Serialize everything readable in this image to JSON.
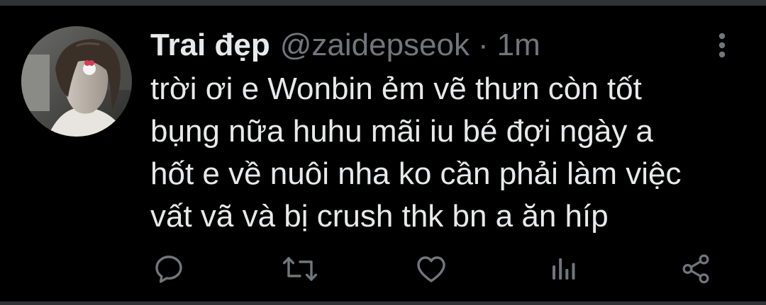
{
  "tweet": {
    "display_name": "Trai đẹp",
    "handle": "@zaidepseok",
    "separator": "·",
    "time": "1m",
    "text_lines": [
      "trời ơi e Wonbin ẻm vẽ thưn còn tốt",
      "bụng nữa huhu mãi iu bé đợi ngày a",
      "hốt e về nuôi nha ko cần phải làm việc",
      "vất vã và bị crush thk bn a ăn híp"
    ]
  },
  "icons": {
    "more": "more-vertical-icon",
    "reply": "reply-icon",
    "retweet": "retweet-icon",
    "like": "heart-icon",
    "analytics": "analytics-icon",
    "share": "share-icon",
    "avatar": "user-avatar-photo"
  },
  "colors": {
    "background": "#000000",
    "text_primary": "#e7e9ea",
    "text_secondary": "#71767b",
    "icon": "#71767b",
    "divider": "#2f3336"
  }
}
